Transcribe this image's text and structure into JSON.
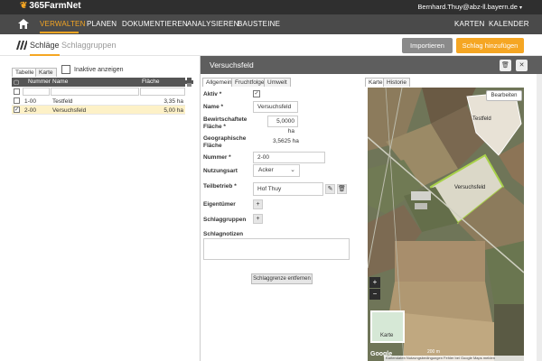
{
  "app": {
    "logo_text": "365FarmNet",
    "user": "Bernhard.Thuy@abz-ll.bayern.de"
  },
  "nav": {
    "items": [
      "VERWALTEN",
      "PLANEN",
      "DOKUMENTIEREN",
      "ANALYSIEREN",
      "BAUSTEINE"
    ],
    "active": "VERWALTEN",
    "right_items": [
      "KARTEN",
      "KALENDER"
    ]
  },
  "page": {
    "tabs": [
      "Schläge",
      "Schlaggruppen"
    ],
    "active_tab": "Schläge",
    "import_label": "Importieren",
    "add_label": "Schlag hinzufügen"
  },
  "list": {
    "view_tabs": [
      "Tabelle",
      "Karte"
    ],
    "inactive_label": "Inaktive anzeigen",
    "columns": [
      "Nummer",
      "Name",
      "Fläche"
    ],
    "rows": [
      {
        "number": "1-00",
        "name": "Testfeld",
        "area": "3,35 ha",
        "checked": false,
        "selected": false
      },
      {
        "number": "2-00",
        "name": "Versuchsfeld",
        "area": "5,00 ha",
        "checked": true,
        "selected": true
      }
    ]
  },
  "detail": {
    "title": "Versuchsfeld",
    "tabs": [
      "Allgemein",
      "Fruchtfolge",
      "Umwelt"
    ],
    "labels": {
      "aktiv": "Aktiv *",
      "name": "Name *",
      "bewirt": "Bewirtschaftete Fläche *",
      "geo": "Geographische Fläche",
      "nummer": "Nummer *",
      "nutzungsart": "Nutzungsart",
      "teilbetrieb": "Teilbetrieb *",
      "eigentuemer": "Eigentümer",
      "schlaggruppen": "Schlaggruppen",
      "notizen": "Schlagnotizen"
    },
    "values": {
      "name": "Versuchsfeld",
      "bewirt": "5,0000 ha",
      "geo": "3,5625 ha",
      "nummer": "2-00",
      "nutzungsart": "Acker",
      "teilbetrieb": "Hof Thuy"
    },
    "remove_label": "Schlaggrenze entfernen"
  },
  "map": {
    "tabs": [
      "Karte",
      "Historie"
    ],
    "edit_label": "Bearbeiten",
    "field_labels": [
      "Testfeld",
      "Versuchsfeld"
    ],
    "mini_label": "Karte",
    "google": "Google",
    "scale": "200 m",
    "attribution": "Kartendaten Nutzungsbedingungen Fehler bei Google Maps melden"
  }
}
